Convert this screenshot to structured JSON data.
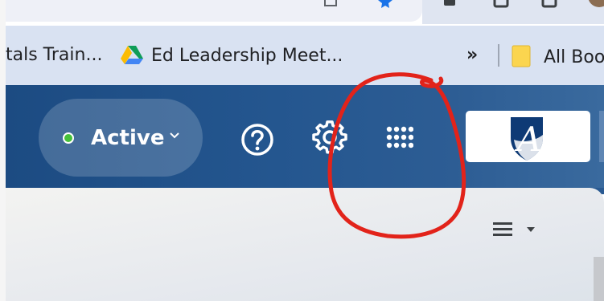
{
  "bookmarks_bar": {
    "items": [
      {
        "label": "tals Train...",
        "icon": "partial-link"
      },
      {
        "label": "Ed Leadership Meet...",
        "icon": "google-drive-icon"
      },
      {
        "label": "»",
        "icon": "chevron-double-right-icon"
      },
      {
        "label": "All Boo",
        "icon": "folder-icon"
      }
    ]
  },
  "header": {
    "status": {
      "label": "Active",
      "dot_color": "#46c13a"
    },
    "actions": [
      {
        "name": "help",
        "icon": "help-circle-icon"
      },
      {
        "name": "settings",
        "icon": "gear-icon"
      },
      {
        "name": "apps",
        "icon": "apps-grid-icon"
      }
    ],
    "logo": {
      "text": "A",
      "color": "#0e3a75"
    }
  },
  "content": {
    "menu": {
      "icon": "menu-lines-icon"
    },
    "peek_text": "",
    "scrollbar": true
  },
  "annotation": {
    "color": "#e2231a",
    "shape": "freehand circle around apps button"
  }
}
